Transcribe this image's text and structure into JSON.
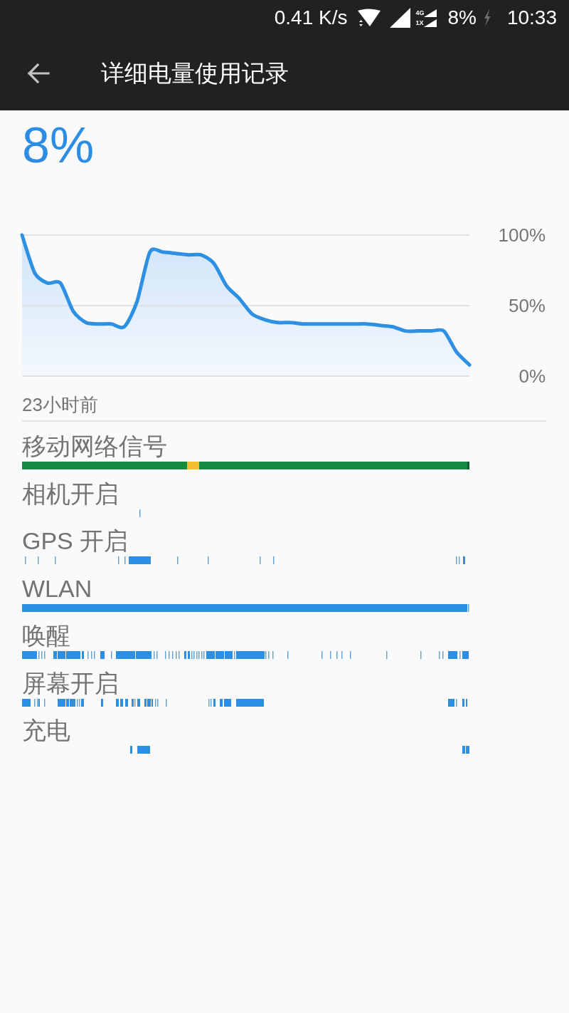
{
  "status_bar": {
    "network_speed": "0.41 K/s",
    "sim_labels": [
      "4G",
      "1X"
    ],
    "battery": "8%",
    "charging": true,
    "time": "10:33"
  },
  "app_bar": {
    "title": "详细电量使用记录"
  },
  "battery_level": "8%",
  "chart": {
    "chart_data": {
      "type": "area",
      "values": [
        100,
        73,
        66,
        66,
        46,
        38,
        37,
        37,
        35,
        53,
        88,
        88,
        87,
        86,
        86,
        80,
        64,
        55,
        44,
        40,
        38,
        38,
        37,
        37,
        37,
        37,
        37,
        37,
        36,
        35,
        32,
        32,
        32,
        32,
        17,
        8
      ],
      "ylim": [
        0,
        100
      ],
      "yticks": [
        {
          "value": 0,
          "label": "0%"
        },
        {
          "value": 50,
          "label": "50%"
        },
        {
          "value": 100,
          "label": "100%"
        }
      ]
    },
    "start_label": "23小时前"
  },
  "timelines": [
    {
      "label": "移动网络信号",
      "kind": "signal"
    },
    {
      "label": "相机开启",
      "kind": "activity"
    },
    {
      "label": "GPS 开启",
      "kind": "activity"
    },
    {
      "label": "WLAN",
      "kind": "activity"
    },
    {
      "label": "唤醒",
      "kind": "activity"
    },
    {
      "label": "屏幕开启",
      "kind": "activity"
    },
    {
      "label": "充电",
      "kind": "activity"
    }
  ]
}
